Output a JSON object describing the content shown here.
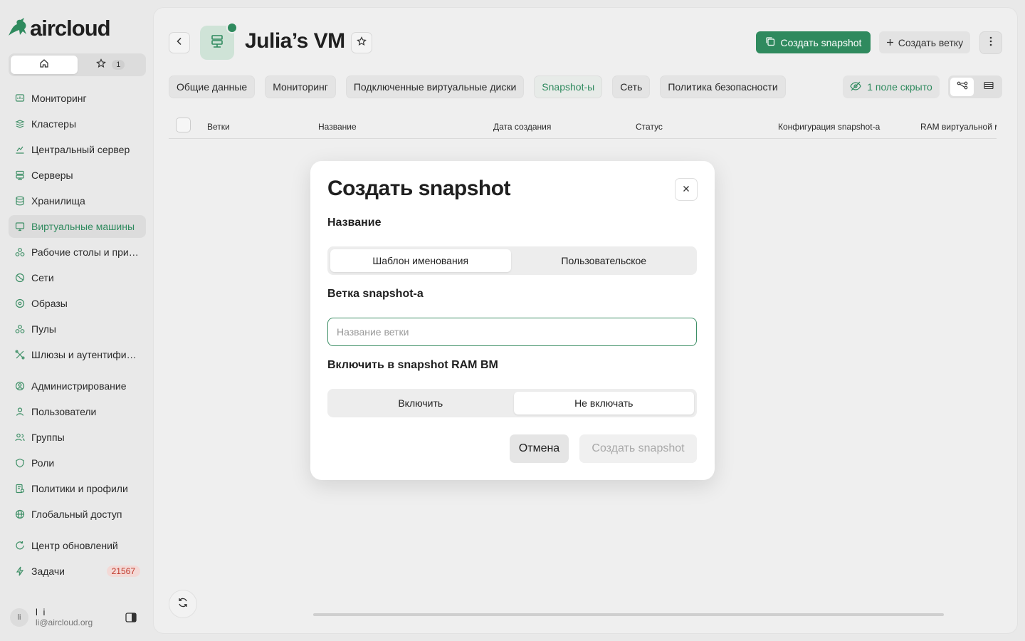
{
  "brand": {
    "name": "aircloud",
    "accent": "#2f8a5e"
  },
  "switcher": {
    "home_icon": "home-icon",
    "favorites_icon": "star-icon",
    "favorites_count": "1"
  },
  "sidebar": {
    "items": [
      {
        "label": "Мониторинг",
        "icon": "monitoring-icon"
      },
      {
        "label": "Кластеры",
        "icon": "clusters-icon"
      },
      {
        "label": "Центральный сервер",
        "icon": "central-server-icon"
      },
      {
        "label": "Серверы",
        "icon": "servers-icon"
      },
      {
        "label": "Хранилища",
        "icon": "storage-icon"
      },
      {
        "label": "Виртуальные машины",
        "icon": "vm-icon",
        "active": true
      },
      {
        "label": "Рабочие столы и прил...",
        "icon": "desktops-icon"
      },
      {
        "label": "Сети",
        "icon": "networks-icon"
      },
      {
        "label": "Образы",
        "icon": "images-icon"
      },
      {
        "label": "Пулы",
        "icon": "pools-icon"
      },
      {
        "label": "Шлюзы и аутентифика...",
        "icon": "gateways-icon"
      },
      {
        "label": "Администрирование",
        "icon": "admin-icon"
      },
      {
        "label": "Пользователи",
        "icon": "users-icon"
      },
      {
        "label": "Группы",
        "icon": "groups-icon"
      },
      {
        "label": "Роли",
        "icon": "roles-icon"
      },
      {
        "label": "Политики и профили",
        "icon": "policies-icon"
      },
      {
        "label": "Глобальный доступ",
        "icon": "global-access-icon"
      },
      {
        "label": "Центр обновлений",
        "icon": "updates-icon"
      },
      {
        "label": "Задачи",
        "icon": "tasks-icon",
        "badge": "21567"
      }
    ]
  },
  "user": {
    "initials": "li",
    "name": "l i",
    "email": "li@aircloud.org"
  },
  "header": {
    "title": "Julia’s VM",
    "create_snapshot": "Создать snapshot",
    "create_branch": "Создать ветку"
  },
  "tabs": [
    {
      "label": "Общие данные"
    },
    {
      "label": "Мониторинг"
    },
    {
      "label": "Подключенные виртуальные диски"
    },
    {
      "label": "Snapshot-ы",
      "active": true
    },
    {
      "label": "Сеть"
    },
    {
      "label": "Политика безопасности"
    }
  ],
  "hidden_fields": "1 поле скрыто",
  "table": {
    "columns": [
      "Ветки",
      "Название",
      "Дата создания",
      "Статус",
      "Конфигурация snapshot-а",
      "RAM виртуальной ма"
    ]
  },
  "modal": {
    "title": "Создать snapshot",
    "name_label": "Название",
    "name_options": [
      "Шаблон именования",
      "Пользовательское"
    ],
    "name_selected": 0,
    "branch_label": "Ветка snapshot-а",
    "branch_placeholder": "Название ветки",
    "branch_value": "",
    "ram_label": "Включить в snapshot RAM ВМ",
    "ram_options": [
      "Включить",
      "Не включать"
    ],
    "ram_selected": 1,
    "cancel": "Отмена",
    "submit": "Создать snapshot"
  }
}
